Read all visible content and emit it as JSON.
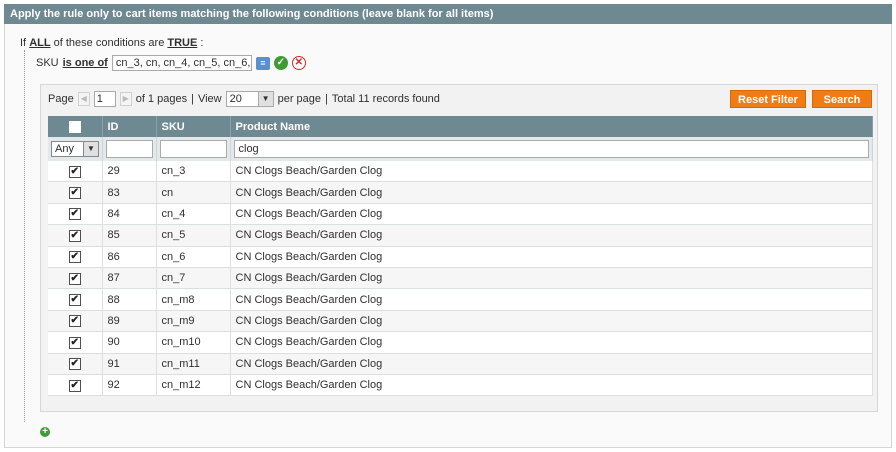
{
  "fieldset": {
    "title": "Apply the rule only to cart items matching the following conditions (leave blank for all items)"
  },
  "rule": {
    "prefix": "If",
    "aggregator": "ALL",
    "middle": "of these conditions are",
    "value": "TRUE",
    "suffix": ":"
  },
  "condition": {
    "attribute": "SKU",
    "operator": "is one of",
    "value": "cn_3, cn, cn_4, cn_5, cn_6, cn_"
  },
  "pager": {
    "page_label": "Page",
    "page_value": "1",
    "of_pages": "of 1 pages",
    "sep1": "|",
    "view_label": "View",
    "per_page": "20",
    "per_page_label": "per page",
    "sep2": "|",
    "total": "Total 11 records found"
  },
  "buttons": {
    "reset_filter": "Reset Filter",
    "search": "Search"
  },
  "columns": {
    "id": "ID",
    "sku": "SKU",
    "name": "Product Name"
  },
  "filters": {
    "select": "Any",
    "id": "",
    "sku": "",
    "name": "clog"
  },
  "rows": [
    {
      "checked": "✔",
      "id": "29",
      "sku": "cn_3",
      "name": "CN Clogs Beach/Garden Clog"
    },
    {
      "checked": "✔",
      "id": "83",
      "sku": "cn",
      "name": "CN Clogs Beach/Garden Clog"
    },
    {
      "checked": "✔",
      "id": "84",
      "sku": "cn_4",
      "name": "CN Clogs Beach/Garden Clog"
    },
    {
      "checked": "✔",
      "id": "85",
      "sku": "cn_5",
      "name": "CN Clogs Beach/Garden Clog"
    },
    {
      "checked": "✔",
      "id": "86",
      "sku": "cn_6",
      "name": "CN Clogs Beach/Garden Clog"
    },
    {
      "checked": "✔",
      "id": "87",
      "sku": "cn_7",
      "name": "CN Clogs Beach/Garden Clog"
    },
    {
      "checked": "✔",
      "id": "88",
      "sku": "cn_m8",
      "name": "CN Clogs Beach/Garden Clog"
    },
    {
      "checked": "✔",
      "id": "89",
      "sku": "cn_m9",
      "name": "CN Clogs Beach/Garden Clog"
    },
    {
      "checked": "✔",
      "id": "90",
      "sku": "cn_m10",
      "name": "CN Clogs Beach/Garden Clog"
    },
    {
      "checked": "✔",
      "id": "91",
      "sku": "cn_m11",
      "name": "CN Clogs Beach/Garden Clog"
    },
    {
      "checked": "✔",
      "id": "92",
      "sku": "cn_m12",
      "name": "CN Clogs Beach/Garden Clog"
    }
  ],
  "icons": {
    "chooser": "list-icon",
    "apply": "apply-icon",
    "remove": "remove-icon",
    "add": "add-condition-icon"
  },
  "colors": {
    "header": "#6f8992",
    "accent": "#f27c14"
  }
}
